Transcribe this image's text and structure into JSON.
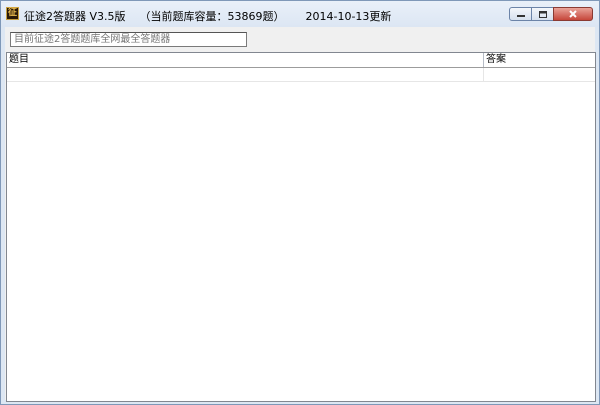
{
  "window": {
    "icon_glyph": "征",
    "title_app": "征途2答题器 V3.5版",
    "title_capacity": "（当前题库容量：53869题）",
    "title_date": "2014-10-13更新"
  },
  "search": {
    "placeholder": "目前征途2答题题库全网最全答题器"
  },
  "table": {
    "columns": [
      "题目",
      "答案"
    ],
    "rows": [
      {
        "question": "",
        "answer": ""
      }
    ]
  }
}
